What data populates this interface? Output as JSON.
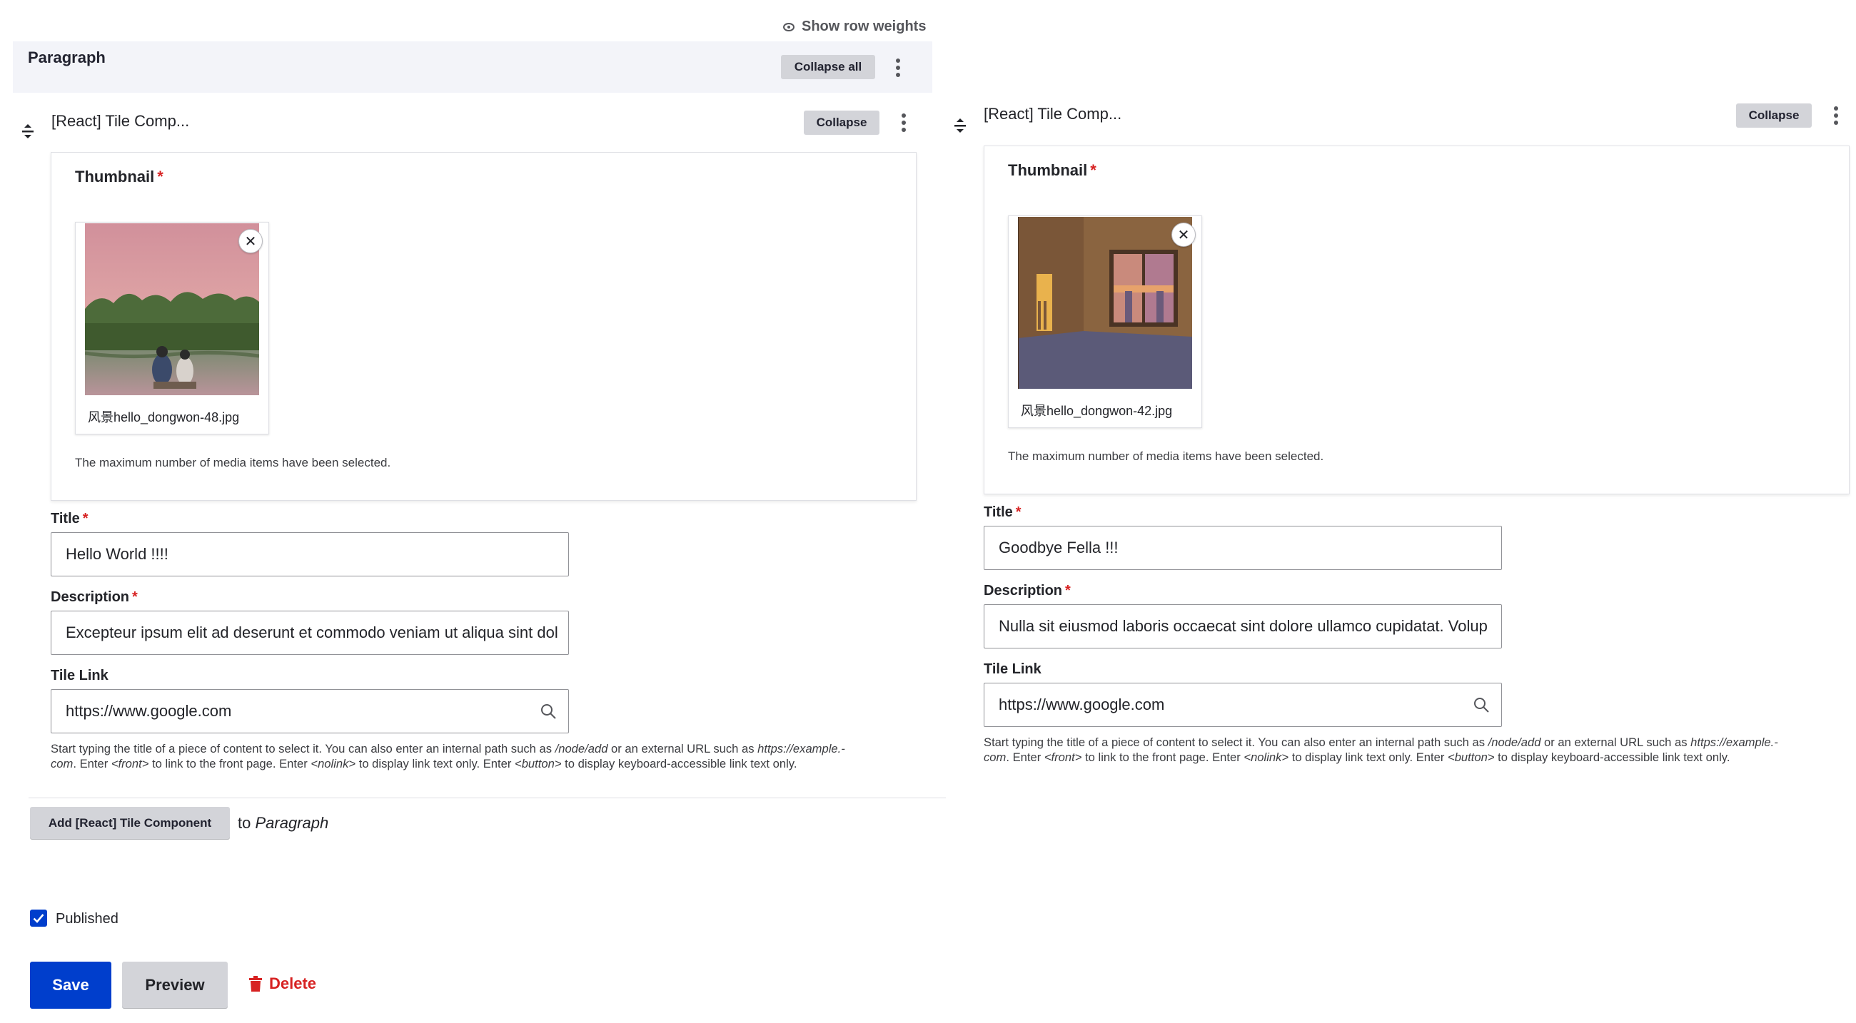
{
  "toolbar": {
    "show_row_weights": "Show row weights"
  },
  "paragraph": {
    "title": "Paragraph",
    "collapse_all": "Collapse all"
  },
  "items": [
    {
      "title": "[React] Tile Comp...",
      "collapse": "Collapse",
      "thumbnail_label": "Thumbnail",
      "media_filename": "风景hello_dongwon-48.jpg",
      "remove_symbol": "✕",
      "max_note": "The maximum number of media items have been selected.",
      "title_label": "Title",
      "title_value": "Hello World !!!!",
      "description_label": "Description",
      "description_value": "Excepteur ipsum elit ad deserunt et commodo veniam ut aliqua sint dol",
      "tile_link_label": "Tile Link",
      "tile_link_value": "https://www.google.com"
    },
    {
      "title": "[React] Tile Comp...",
      "collapse": "Collapse",
      "thumbnail_label": "Thumbnail",
      "media_filename": "风景hello_dongwon-42.jpg",
      "remove_symbol": "✕",
      "max_note": "The maximum number of media items have been selected.",
      "title_label": "Title",
      "title_value": "Goodbye Fella !!!",
      "description_label": "Description",
      "description_value": "Nulla sit eiusmod laboris occaecat sint dolore ullamco cupidatat. Volup",
      "tile_link_label": "Tile Link",
      "tile_link_value": "https://www.google.com"
    }
  ],
  "help_text": {
    "p1": "Start typing the title of a piece of content to select it. You can also enter an internal path such as ",
    "e1": "/node/add",
    "p2": " or an external URL such as ",
    "e2": "https://example.-",
    "e3": "com",
    "p3": ". Enter ",
    "e4": "<front>",
    "p4": " to link to the front page. Enter ",
    "e5": "<nolink>",
    "p5": " to display link text only. Enter ",
    "e6": "<button>",
    "p6": " to display keyboard-accessible link text only."
  },
  "add": {
    "button": "Add [React] Tile Component",
    "to": "to ",
    "target": "Paragraph"
  },
  "published": {
    "label": "Published",
    "checked": true
  },
  "actions": {
    "save": "Save",
    "preview": "Preview",
    "delete": "Delete"
  },
  "colors": {
    "primary": "#003ecc",
    "danger": "#d72222",
    "required": "#d72222",
    "button_gray": "#d3d4d9"
  },
  "icons": [
    "eye-icon",
    "kebab-menu-icon",
    "drag-handle-icon",
    "close-icon",
    "search-icon",
    "checkmark-icon",
    "trash-icon"
  ]
}
